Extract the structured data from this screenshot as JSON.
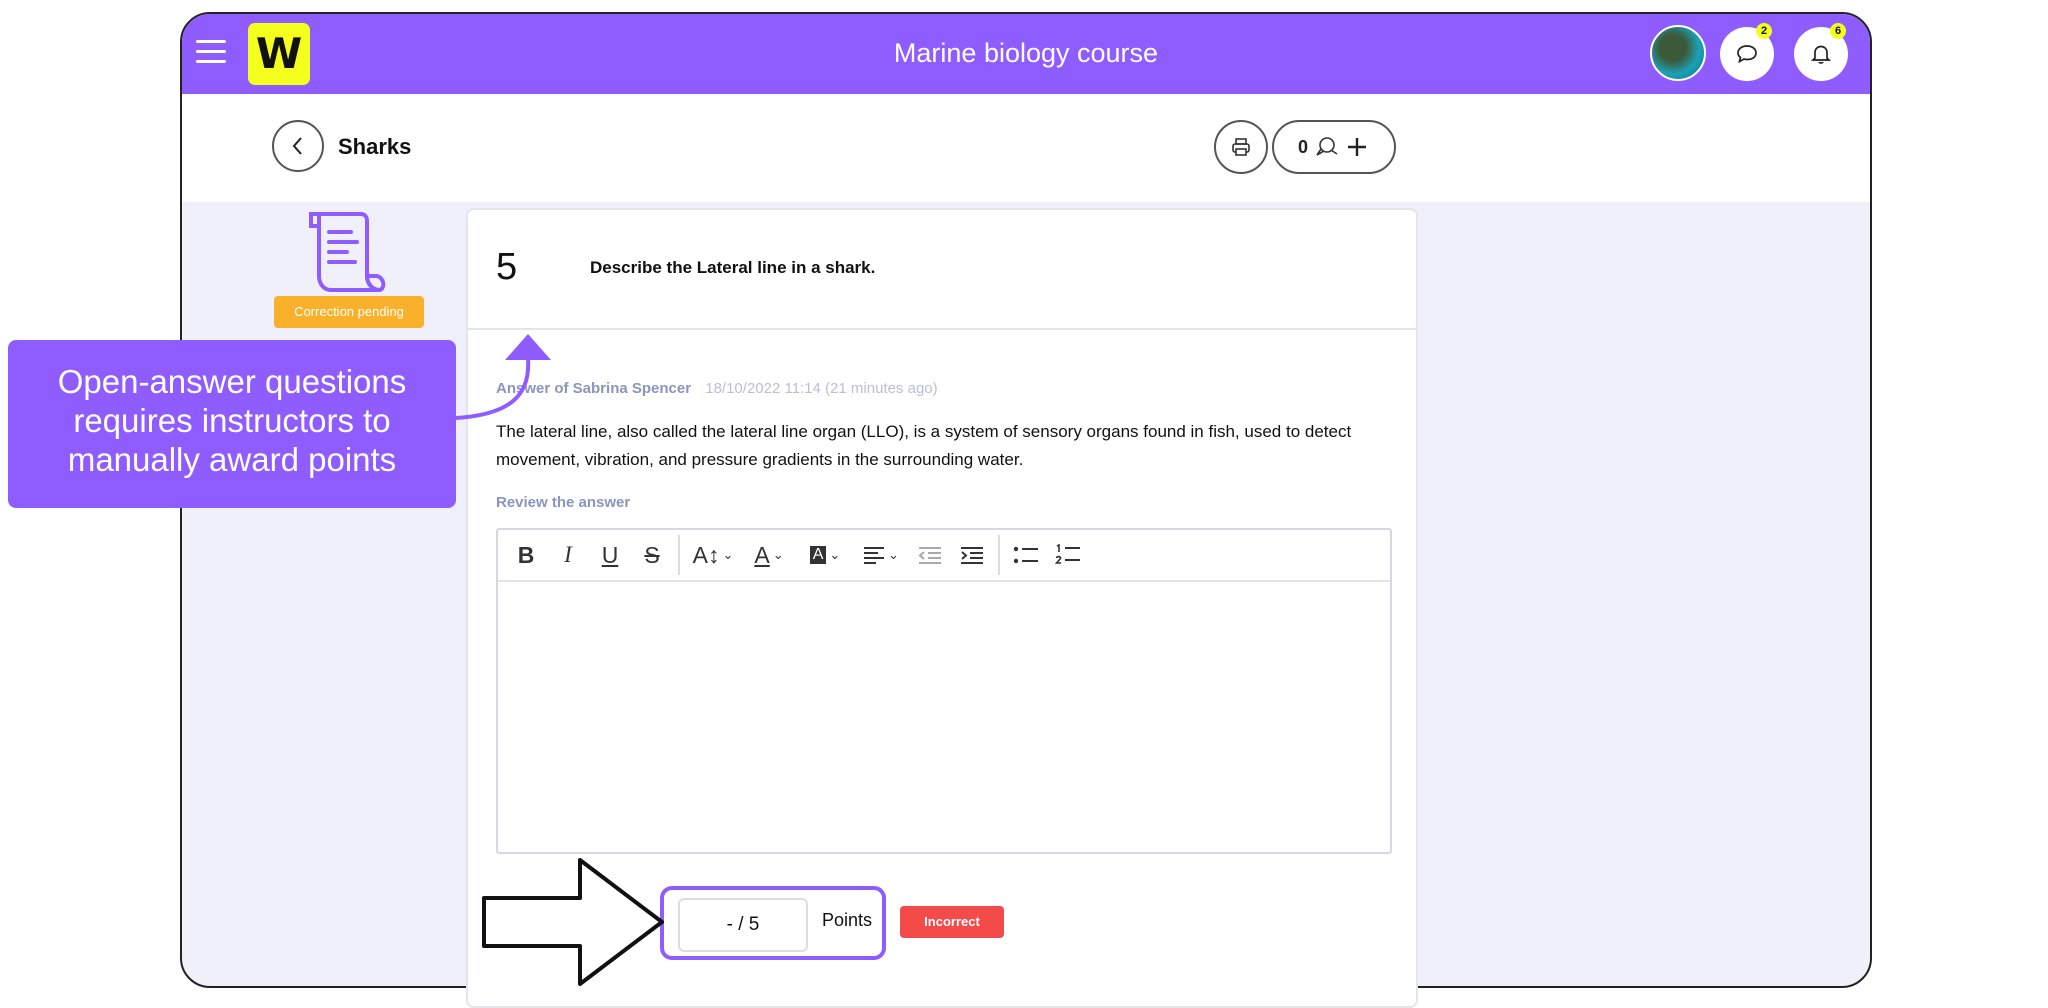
{
  "header": {
    "title": "Marine biology course",
    "logo": "W",
    "messages_count": "2",
    "notifications_count": "6"
  },
  "page": {
    "title": "Sharks",
    "comments_count": "0"
  },
  "question": {
    "status": "Correction pending",
    "number": "5",
    "text": "Describe the Lateral line in a shark.",
    "answer_author": "Answer of Sabrina Spencer",
    "answer_time": "18/10/2022 11:14 (21 minutes ago)",
    "answer_text": "The lateral line, also called the lateral line organ (LLO), is a system of sensory organs found in fish, used to detect movement, vibration, and pressure gradients in the surrounding water.",
    "review_label": "Review the answer"
  },
  "toolbar": {
    "bold": "B",
    "italic": "I",
    "underline": "U",
    "strike": "S",
    "font_size": "A↕",
    "font_color": "A",
    "highlight": "A"
  },
  "grading": {
    "points_value": "- / 5",
    "points_label": "Points",
    "incorrect_label": "Incorrect"
  },
  "callout": {
    "text": "Open-answer questions requires instructors to manually award points"
  },
  "colors": {
    "brand": "#8f5cff",
    "logo_bg": "#f4ff1e",
    "pending": "#f9b12c",
    "incorrect": "#f34a4a"
  }
}
